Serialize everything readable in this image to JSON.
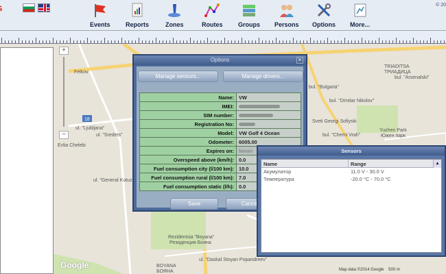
{
  "app": {
    "logo": "S",
    "copyright": "© 20"
  },
  "toolbar": {
    "items": [
      {
        "label": "Events",
        "icon": "events-flag-icon"
      },
      {
        "label": "Reports",
        "icon": "reports-icon"
      },
      {
        "label": "Zones",
        "icon": "zones-icon"
      },
      {
        "label": "Routes",
        "icon": "routes-icon"
      },
      {
        "label": "Groups",
        "icon": "groups-icon"
      },
      {
        "label": "Persons",
        "icon": "persons-icon"
      },
      {
        "label": "Options",
        "icon": "tools-icon"
      },
      {
        "label": "More...",
        "icon": "more-icon"
      }
    ],
    "flags": [
      "bg-flag-icon",
      "uk-flag-icon"
    ]
  },
  "map": {
    "labels": [
      "TRIADITSA",
      "ТРИАДИЦА",
      "Yuzhen Park",
      "Южен парк",
      "Rezidentsia \"Boyana\"",
      "Резиденция Бояна",
      "BOYANA",
      "БОЯНА",
      "Felkov",
      "18",
      "ul. \"Ljubljana\"",
      "ul. \"Sredets\"",
      "Evlia Chelebi",
      "ul. \"General Kutuzov\"",
      "bul. \"Bulgaria\"",
      "ul. \"Daskal Stoyan Popandreev\"",
      "bul. \"Arsenalski\"",
      "Sveti Georgi Sofiyski",
      "bul. \"Cherni Vrah\"",
      "bul. \"Dimitar Nikolov\""
    ],
    "google_logo": "Google",
    "attribution": "Map data ©2014 Google",
    "scale": "500 m"
  },
  "options_dialog": {
    "title": "Options",
    "manage_sensors": "Manage sensors...",
    "manage_drivers": "Manage drivers...",
    "fields": [
      {
        "label": "Name:",
        "value": "VW"
      },
      {
        "label": "IMEI:",
        "value": ""
      },
      {
        "label": "SIM number:",
        "value": ""
      },
      {
        "label": "Registration No:",
        "value": ""
      },
      {
        "label": "Model:",
        "value": "VW Golf 4 Ocean"
      },
      {
        "label": "Odometer:",
        "value": "6005.00"
      },
      {
        "label": "Expires on:",
        "value": "Never"
      },
      {
        "label": "Overspeed above (km/h):",
        "value": "0.0"
      },
      {
        "label": "Fuel consumption city (l/100 km):",
        "value": "10.0"
      },
      {
        "label": "Fuel consumption rural (l/100 km):",
        "value": "7.0"
      },
      {
        "label": "Fuel consumption static (l/h):",
        "value": "0.0"
      }
    ],
    "save": "Save",
    "cancel": "Cancel"
  },
  "sensors_dialog": {
    "title": "Sensors",
    "columns": [
      "Name",
      "Range"
    ],
    "rows": [
      {
        "name": "Акумулатор",
        "range": "11.0 V - 30.0 V"
      },
      {
        "name": "Температура",
        "range": "-20.0 °C - 70.0 °C"
      }
    ]
  }
}
